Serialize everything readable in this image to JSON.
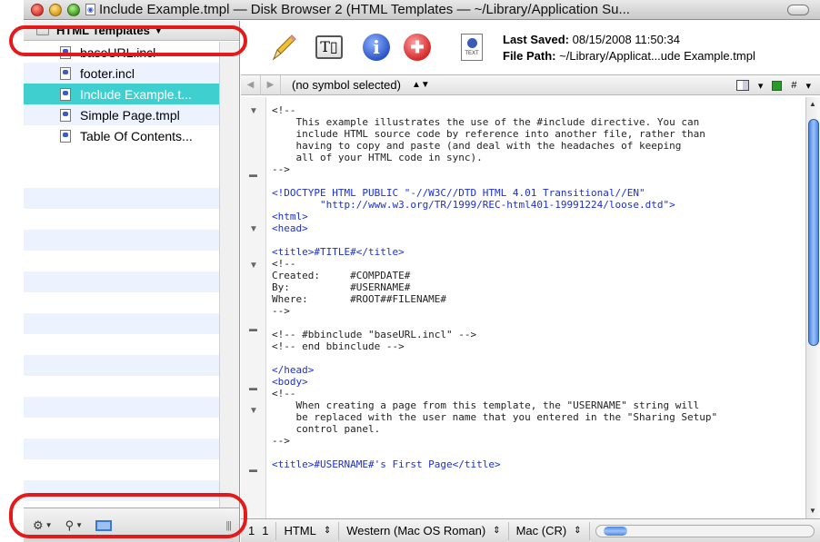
{
  "window": {
    "title": "Include Example.tmpl — Disk Browser 2 (HTML Templates — ~/Library/Application Su..."
  },
  "sidebar": {
    "folder_label": "HTML Templates",
    "files": [
      {
        "label": "baseURL.incl",
        "selected": false
      },
      {
        "label": "footer.incl",
        "selected": false
      },
      {
        "label": "Include Example.t...",
        "selected": true
      },
      {
        "label": "Simple Page.tmpl",
        "selected": false
      },
      {
        "label": "Table Of Contents...",
        "selected": false
      }
    ],
    "footer": {
      "action_icon": "gear-icon",
      "search_icon": "magnifier-icon",
      "view_icon": "panel-view-icon"
    }
  },
  "editor": {
    "last_saved_key": "Last Saved:",
    "last_saved_value": "08/15/2008 11:50:34",
    "file_path_key": "File Path:",
    "file_path_value": "~/Library/Applicat...ude Example.tmpl",
    "symbol_popup": "(no symbol selected)",
    "nav_hash": "#",
    "doc_icon_text": "TEXT",
    "code_lines": [
      "<!--",
      "    This example illustrates the use of the #include directive. You can",
      "    include HTML source code by reference into another file, rather than",
      "    having to copy and paste (and deal with the headaches of keeping",
      "    all of your HTML code in sync).",
      "-->",
      "",
      "<!DOCTYPE HTML PUBLIC \"-//W3C//DTD HTML 4.01 Transitional//EN\"",
      "        \"http://www.w3.org/TR/1999/REC-html401-19991224/loose.dtd\">",
      "<html>",
      "<head>",
      "",
      "<title>#TITLE#</title>",
      "<!--",
      "Created:     #COMPDATE#",
      "By:          #USERNAME#",
      "Where:       #ROOT##FILENAME#",
      "-->",
      "",
      "<!-- #bbinclude \"baseURL.incl\" -->",
      "<!-- end bbinclude -->",
      "",
      "</head>",
      "<body>",
      "<!--",
      "    When creating a page from this template, the \"USERNAME\" string will",
      "    be replaced with the user name that you entered in the \"Sharing Setup\"",
      "    control panel.",
      "-->",
      "",
      "<title>#USERNAME#'s First Page</title>"
    ],
    "status": {
      "line": "1",
      "col": "1",
      "language": "HTML",
      "encoding": "Western (Mac OS Roman)",
      "line_endings": "Mac (CR)"
    }
  },
  "colors": {
    "selection": "#3fcfcf",
    "annotation": "#e41a1a",
    "tag": "#1b2fd6"
  }
}
